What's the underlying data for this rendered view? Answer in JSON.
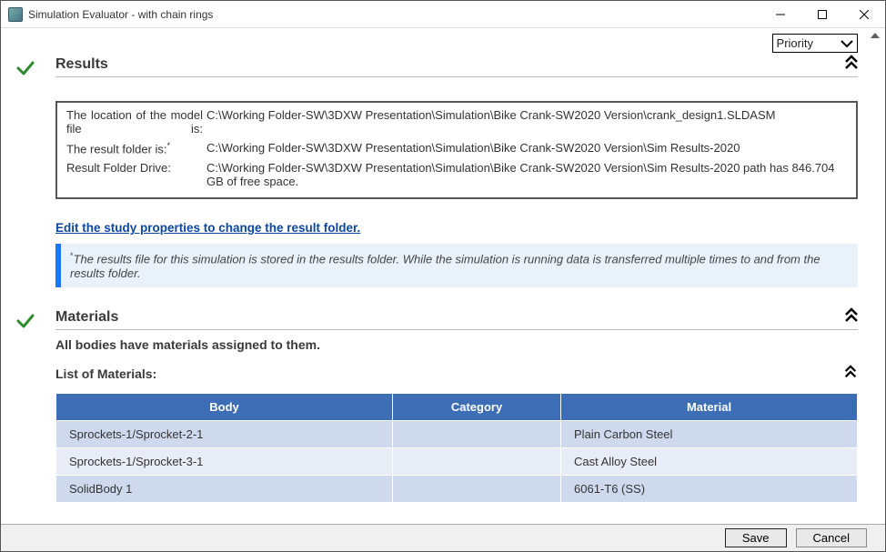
{
  "window": {
    "title": "Simulation Evaluator - with chain rings"
  },
  "toolbar": {
    "priority_label": "Priority"
  },
  "results": {
    "heading": "Results",
    "rows": [
      {
        "label": "The location of the model file is:",
        "value": "C:\\Working Folder-SW\\3DXW Presentation\\Simulation\\Bike Crank-SW2020 Version\\crank_design1.SLDASM"
      },
      {
        "label": "The result folder is:",
        "sup": "*",
        "value": "C:\\Working Folder-SW\\3DXW Presentation\\Simulation\\Bike Crank-SW2020 Version\\Sim Results-2020"
      },
      {
        "label": "Result Folder Drive:",
        "value": "C:\\Working Folder-SW\\3DXW Presentation\\Simulation\\Bike Crank-SW2020 Version\\Sim Results-2020 path has 846.704 GB of free space."
      }
    ],
    "link": "Edit the study properties to change the result folder.",
    "note_sup": "*",
    "note": "The results file for this simulation is stored in the results folder. While the simulation is running data is transferred multiple times to and from the results folder."
  },
  "materials": {
    "heading": "Materials",
    "status": "All bodies have materials assigned to them.",
    "list_header": "List of Materials:",
    "columns": {
      "body": "Body",
      "category": "Category",
      "material": "Material"
    },
    "rows": [
      {
        "body": "Sprockets-1/Sprocket-2-1",
        "category": "",
        "material": "Plain Carbon Steel"
      },
      {
        "body": "Sprockets-1/Sprocket-3-1",
        "category": "",
        "material": "Cast Alloy Steel"
      },
      {
        "body": "SolidBody 1",
        "category": "",
        "material": "6061-T6 (SS)"
      }
    ]
  },
  "footer": {
    "save": "Save",
    "cancel": "Cancel"
  }
}
